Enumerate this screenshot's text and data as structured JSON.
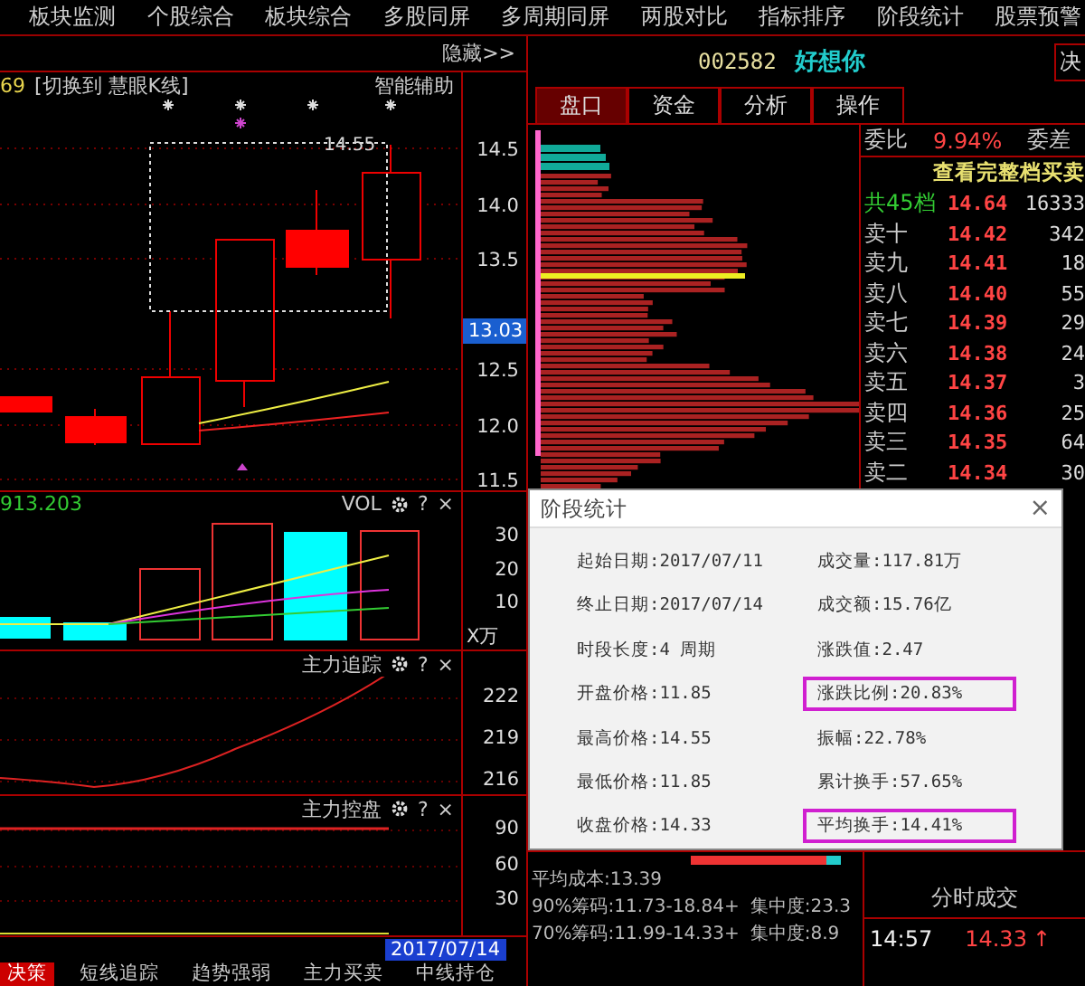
{
  "menu": [
    "板块监测",
    "个股综合",
    "板块综合",
    "多股同屏",
    "多周期同屏",
    "两股对比",
    "指标排序",
    "阶段统计",
    "股票预警"
  ],
  "chart_toolbar": {
    "hide_button": "隐藏>>"
  },
  "kline": {
    "header_value": "69",
    "switch_link": "[切换到 慧眼K线]",
    "assist_label": "智能辅助",
    "high_marker": "14.55",
    "price_axis": [
      "14.5",
      "14.0",
      "13.5",
      "12.5",
      "12.0",
      "11.5"
    ],
    "current_price": "13.03"
  },
  "volume": {
    "reading": "913.203",
    "title": "VOL",
    "help": "?",
    "close": "×",
    "axis": [
      "30",
      "20",
      "10"
    ],
    "unit": "X万"
  },
  "panels": [
    {
      "title": "主力追踪",
      "help": "?",
      "close": "×",
      "axis": [
        "222",
        "219",
        "216"
      ],
      "kind": "curve"
    },
    {
      "title": "主力控盘",
      "help": "?",
      "close": "×",
      "axis": [
        "90",
        "60",
        "30"
      ],
      "kind": "flat"
    }
  ],
  "date_label": "2017/07/14",
  "bottom_tabs": [
    {
      "label": "决策",
      "selected": true
    },
    {
      "label": "短线追踪",
      "selected": false
    },
    {
      "label": "趋势强弱",
      "selected": false
    },
    {
      "label": "主力买卖",
      "selected": false
    },
    {
      "label": "中线持仓",
      "selected": false
    }
  ],
  "stock": {
    "code": "002582",
    "name": "好想你",
    "side_button": "决"
  },
  "tabs": [
    {
      "label": "盘口",
      "selected": true
    },
    {
      "label": "资金",
      "selected": false
    },
    {
      "label": "分析",
      "selected": false
    },
    {
      "label": "操作",
      "selected": false
    }
  ],
  "order_book": {
    "ratio_label": "委比",
    "ratio": "9.94%",
    "diff_label": "委差",
    "full_link": "查看完整档买卖",
    "rows": [
      {
        "kind": "total",
        "label": "共45档",
        "price": "14.64",
        "volume": "16333"
      },
      {
        "kind": "ask",
        "label": "卖十",
        "price": "14.42",
        "volume": "342"
      },
      {
        "kind": "ask",
        "label": "卖九",
        "price": "14.41",
        "volume": "18"
      },
      {
        "kind": "ask",
        "label": "卖八",
        "price": "14.40",
        "volume": "55"
      },
      {
        "kind": "ask",
        "label": "卖七",
        "price": "14.39",
        "volume": "29"
      },
      {
        "kind": "ask",
        "label": "卖六",
        "price": "14.38",
        "volume": "24"
      },
      {
        "kind": "ask",
        "label": "卖五",
        "price": "14.37",
        "volume": "3"
      },
      {
        "kind": "ask",
        "label": "卖四",
        "price": "14.36",
        "volume": "25"
      },
      {
        "kind": "ask",
        "label": "卖三",
        "price": "14.35",
        "volume": "64"
      },
      {
        "kind": "ask",
        "label": "卖二",
        "price": "14.34",
        "volume": "30"
      }
    ]
  },
  "chip_stats": {
    "average_cost": "平均成本:13.39",
    "rows": [
      {
        "range": "90%筹码:11.73-18.84+",
        "concentration": "集中度:23.3"
      },
      {
        "range": "70%筹码:11.99-14.33+",
        "concentration": "集中度:8.9"
      }
    ]
  },
  "ticks": {
    "title": "分时成交",
    "rows": [
      {
        "time": "14:57",
        "price": "14.33",
        "arrow": "↑"
      }
    ]
  },
  "dialog": {
    "title": "阶段统计",
    "close": "×",
    "items": [
      {
        "text": "起始日期:2017/07/11",
        "highlighted": false
      },
      {
        "text": "成交量:117.81万",
        "highlighted": false
      },
      {
        "text": "终止日期:2017/07/14",
        "highlighted": false
      },
      {
        "text": "成交额:15.76亿",
        "highlighted": false
      },
      {
        "text": "时段长度:4 周期",
        "highlighted": false
      },
      {
        "text": "涨跌值:2.47",
        "highlighted": false
      },
      {
        "text": "开盘价格:11.85",
        "highlighted": false
      },
      {
        "text": "涨跌比例:20.83%",
        "highlighted": true
      },
      {
        "text": "最高价格:14.55",
        "highlighted": false
      },
      {
        "text": "振幅:22.78%",
        "highlighted": false
      },
      {
        "text": "最低价格:11.85",
        "highlighted": false
      },
      {
        "text": "累计换手:57.65%",
        "highlighted": false
      },
      {
        "text": "收盘价格:14.33",
        "highlighted": false
      },
      {
        "text": "平均换手:14.41%",
        "highlighted": true
      }
    ]
  }
}
